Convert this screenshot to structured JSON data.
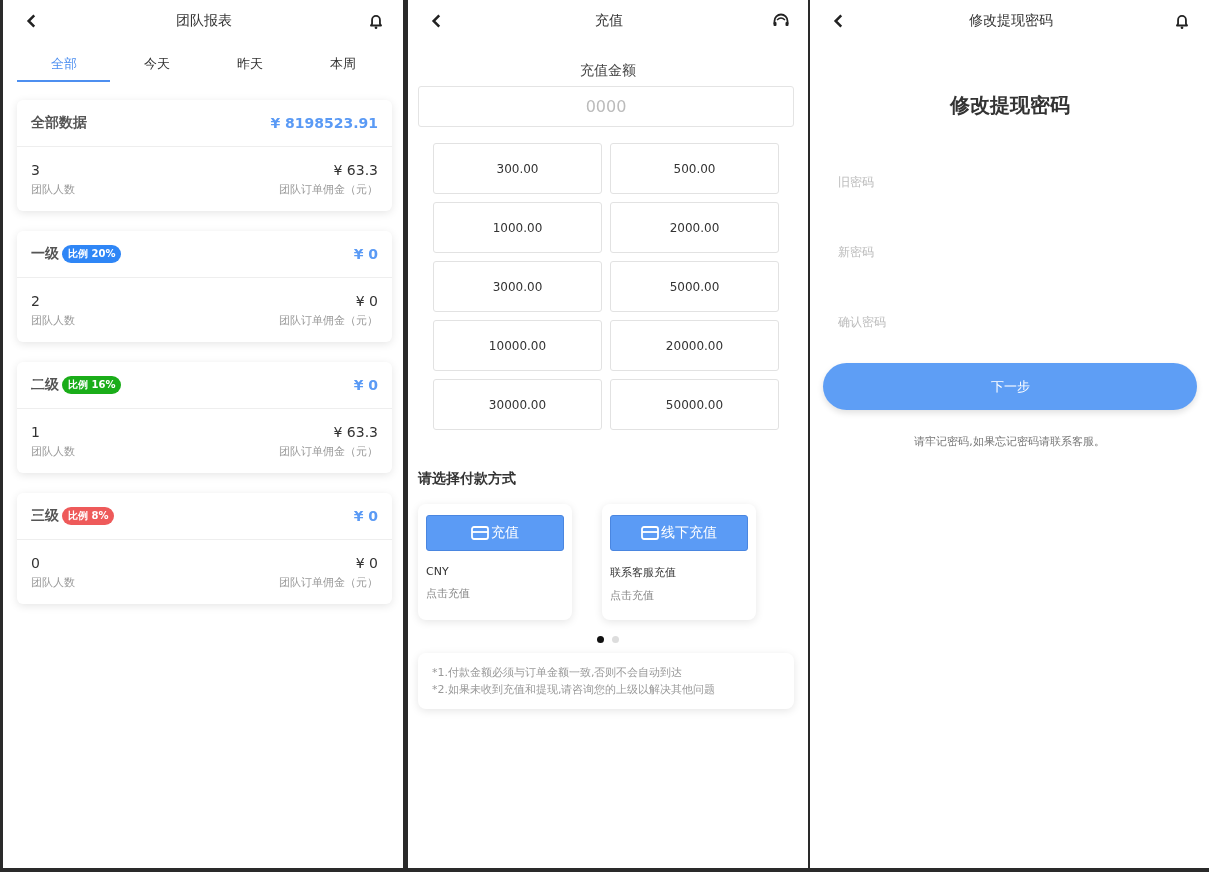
{
  "team_report": {
    "title": "团队报表",
    "tabs": [
      {
        "label": "全部",
        "selected": true
      },
      {
        "label": "今天",
        "selected": false
      },
      {
        "label": "昨天",
        "selected": false
      },
      {
        "label": "本周",
        "selected": false
      }
    ],
    "cards": [
      {
        "name": "全部数据",
        "amount": "¥ 8198523.91",
        "members": "3",
        "members_label": "团队人数",
        "commission": "¥ 63.3",
        "commission_label": "团队订单佣金（元）"
      },
      {
        "name": "一级",
        "badge": "比例 20%",
        "color": "#2f86f6",
        "amount": "¥ 0",
        "members": "2",
        "members_label": "团队人数",
        "commission": "¥ 0",
        "commission_label": "团队订单佣金（元）"
      },
      {
        "name": "二级",
        "badge": "比例 16%",
        "color": "#1aad19",
        "amount": "¥ 0",
        "members": "1",
        "members_label": "团队人数",
        "commission": "¥ 63.3",
        "commission_label": "团队订单佣金（元）"
      },
      {
        "name": "三级",
        "badge": "比例 8%",
        "color": "#ee5a5a",
        "amount": "¥ 0",
        "members": "0",
        "members_label": "团队人数",
        "commission": "¥ 0",
        "commission_label": "团队订单佣金（元）"
      }
    ]
  },
  "recharge": {
    "title": "充值",
    "amount_label": "充值金额",
    "amount_field": {
      "placeholder": "0000"
    },
    "amounts": [
      "300.00",
      "500.00",
      "1000.00",
      "2000.00",
      "3000.00",
      "5000.00",
      "10000.00",
      "20000.00",
      "30000.00",
      "50000.00"
    ],
    "payment_title": "请选择付款方式",
    "methods": [
      {
        "button": "充值",
        "name": "CNY",
        "hint": "点击充值"
      },
      {
        "button": "线下充值",
        "name": "联系客服充值",
        "hint": "点击充值"
      }
    ],
    "pages": [
      {
        "selected": true
      },
      {
        "selected": false
      }
    ],
    "notes": [
      "*1.付款金额必须与订单金额一致,否则不会自动到达",
      "*2.如果未收到充值和提现,请咨询您的上级以解决其他问题"
    ]
  },
  "change_password": {
    "title": "修改提现密码",
    "heading": "修改提现密码",
    "fields": [
      {
        "placeholder": "旧密码"
      },
      {
        "placeholder": "新密码"
      },
      {
        "placeholder": "确认密码"
      }
    ],
    "button": "下一步",
    "hint": "请牢记密码,如果忘记密码请联系客服。"
  }
}
